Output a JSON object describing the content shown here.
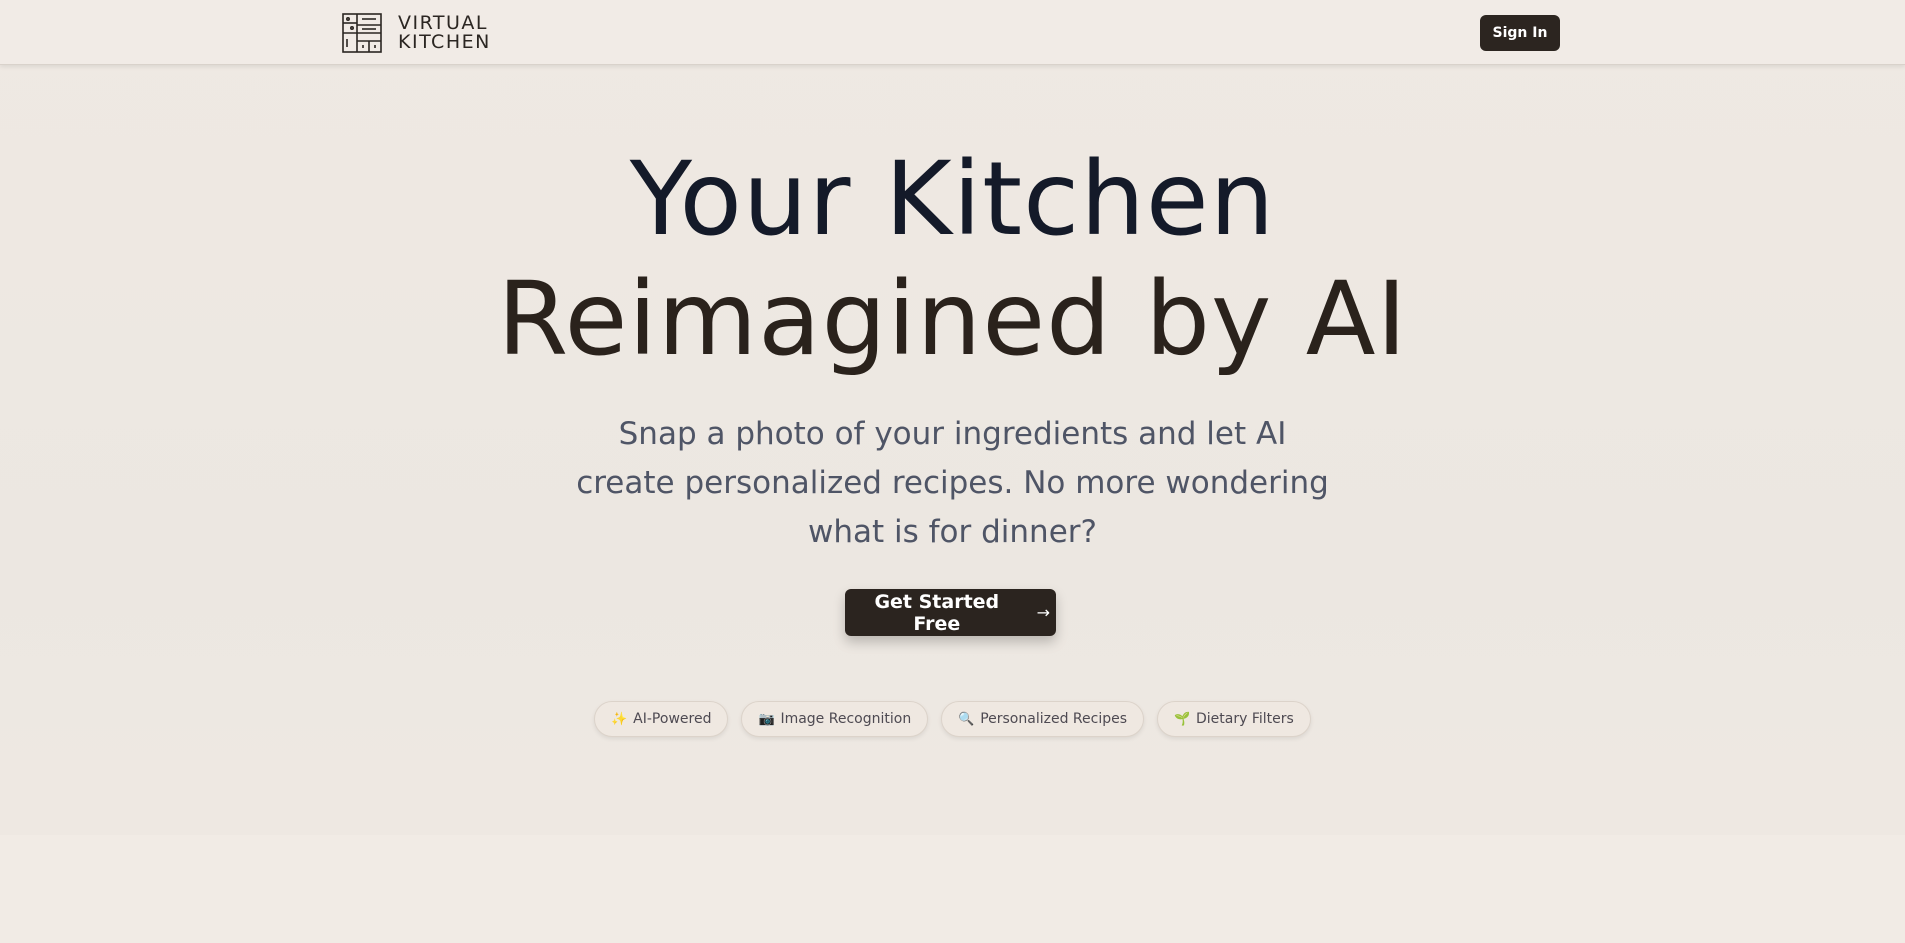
{
  "header": {
    "logo": {
      "line1": "VIRTUAL",
      "line2": "KITCHEN",
      "icon": "kitchen-cabinet-icon"
    },
    "signin_label": "Sign In"
  },
  "hero": {
    "title_line1": "Your Kitchen",
    "title_line2": "Reimagined by AI",
    "subtitle": "Snap a photo of your ingredients and let AI create personalized recipes. No more wondering what is for dinner?",
    "cta_label": "Get Started Free",
    "cta_icon": "arrow-right-icon"
  },
  "features": [
    {
      "icon": "sparkles-icon",
      "glyph": "✨",
      "label": "AI-Powered"
    },
    {
      "icon": "camera-icon",
      "glyph": "📷",
      "label": "Image Recognition"
    },
    {
      "icon": "magnifier-icon",
      "glyph": "🔍",
      "label": "Personalized Recipes"
    },
    {
      "icon": "seedling-icon",
      "glyph": "🌱",
      "label": "Dietary Filters"
    }
  ],
  "colors": {
    "background": "#f1ebe5",
    "button_dark": "#2b241f",
    "title_dark": "#141a29",
    "subtitle": "#4f5566"
  }
}
